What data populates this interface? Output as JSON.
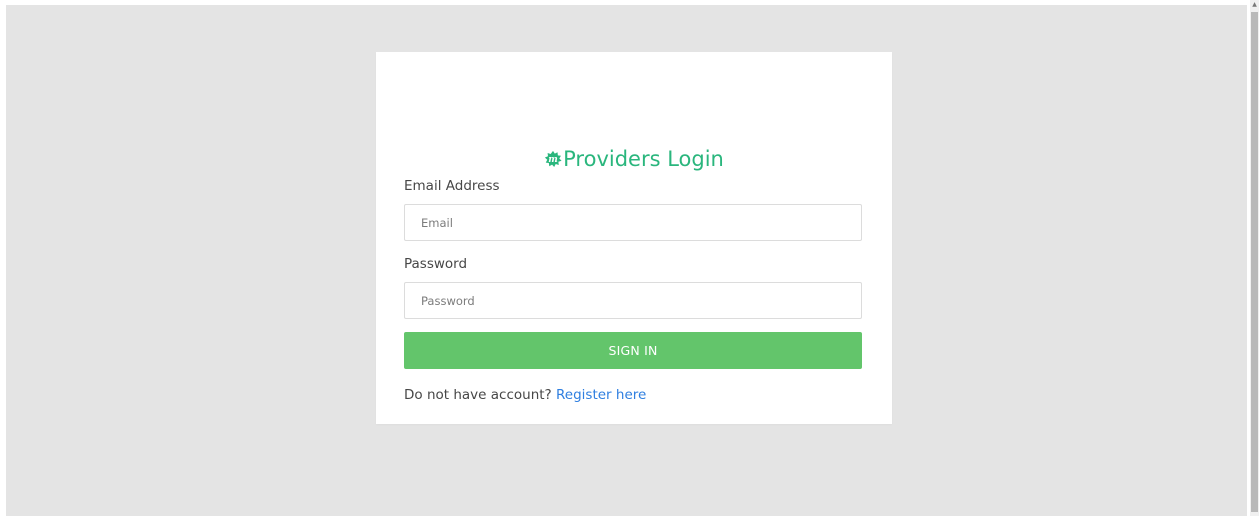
{
  "colors": {
    "page_background": "#e4e4e4",
    "card_background": "#ffffff",
    "title_green": "#2ab67d",
    "button_green": "#63c56b",
    "link_blue": "#2f7fe0"
  },
  "login": {
    "logo_icon": "brand-m-splat-icon",
    "logo_letter": "m",
    "title": "Providers Login",
    "email": {
      "label": "Email Address",
      "placeholder": "Email",
      "value": ""
    },
    "password": {
      "label": "Password",
      "placeholder": "Password",
      "value": ""
    },
    "submit_label": "SIGN IN",
    "register_prompt": "Do not have account?",
    "register_link": "Register here"
  }
}
